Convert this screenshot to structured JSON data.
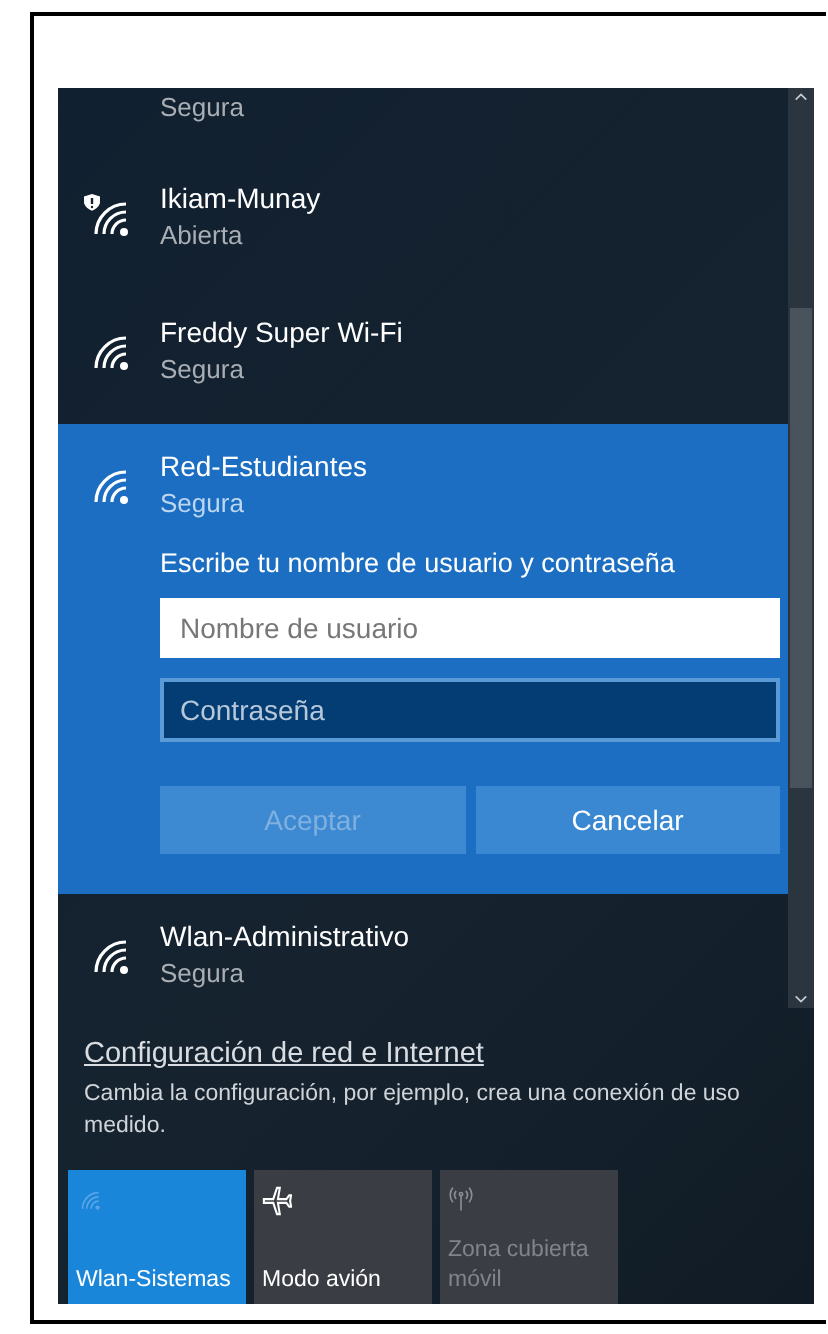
{
  "networks": [
    {
      "status": "Segura",
      "selected": false
    },
    {
      "name": "Ikiam-Munay",
      "status": "Abierta",
      "warning": true,
      "selected": false
    },
    {
      "name": "Freddy Super Wi-Fi",
      "status": "Segura",
      "warning": false,
      "selected": false
    },
    {
      "name": "Red-Estudiantes",
      "status": "Segura",
      "warning": false,
      "selected": true
    },
    {
      "name": "Wlan-Administrativo",
      "status": "Segura",
      "warning": false,
      "selected": false
    }
  ],
  "login": {
    "prompt": "Escribe tu nombre de usuario y contraseña",
    "username": {
      "placeholder": "Nombre de usuario"
    },
    "password": {
      "placeholder": "Contraseña"
    },
    "buttons": [
      {
        "label": "Aceptar",
        "disabled": true
      },
      {
        "label": "Cancelar",
        "disabled": false
      }
    ]
  },
  "settings_link": "Configuración de red e Internet",
  "settings_description": "Cambia la configuración, por ejemplo, crea una conexión de uso medido.",
  "tiles": [
    {
      "kind": "wifi",
      "label": "Wlan-Sistemas",
      "on": true,
      "disabled": false
    },
    {
      "kind": "airplane",
      "label": "Modo avión",
      "on": false,
      "disabled": false
    },
    {
      "kind": "hotspot",
      "label": "Zona cubierta móvil",
      "on": false,
      "disabled": true
    }
  ]
}
